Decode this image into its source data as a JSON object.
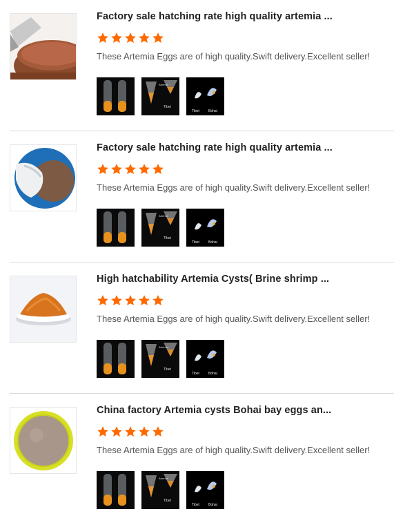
{
  "products": [
    {
      "title": "Factory sale hatching rate high quality artemia ...",
      "rating": 5,
      "description": "These Artemia Eggs are of high quality.Swift delivery.Excellent seller!",
      "thumbnail": "jar-of-brown-powder",
      "gallery": [
        "test-tubes-photo",
        "hatching-cone-photo",
        "shrimp-comparison-photo"
      ],
      "gallery_captions": [
        "Artemia",
        "Tibet",
        "Bohai"
      ]
    },
    {
      "title": "Factory sale hatching rate high quality artemia ...",
      "rating": 5,
      "description": "These Artemia Eggs are of high quality.Swift delivery.Excellent seller!",
      "thumbnail": "pouring-powder-from-cup",
      "gallery": [
        "test-tubes-photo",
        "hatching-cone-photo",
        "shrimp-comparison-photo"
      ],
      "gallery_captions": [
        "Artemia",
        "Tibet",
        "Bohai"
      ]
    },
    {
      "title": "High hatchability Artemia Cysts( Brine shrimp ...",
      "rating": 5,
      "description": "These Artemia Eggs are of high quality.Swift delivery.Excellent seller!",
      "thumbnail": "bowl-of-orange-powder",
      "gallery": [
        "test-tubes-photo",
        "hatching-cone-photo",
        "shrimp-comparison-photo"
      ],
      "gallery_captions": [
        "Artemia",
        "Tibet",
        "Bohai"
      ]
    },
    {
      "title": "China factory Artemia cysts Bohai bay eggs an...",
      "rating": 5,
      "description": "These Artemia Eggs are of high quality.Swift delivery.Excellent seller!",
      "thumbnail": "yellow-dish-of-eggs",
      "gallery": [
        "test-tubes-photo",
        "hatching-cone-photo",
        "shrimp-comparison-photo"
      ],
      "gallery_captions": [
        "Artemia",
        "Tibet",
        "Bohai"
      ]
    }
  ],
  "colors": {
    "star": "#ff6a00",
    "divider": "#d9d9d9"
  }
}
